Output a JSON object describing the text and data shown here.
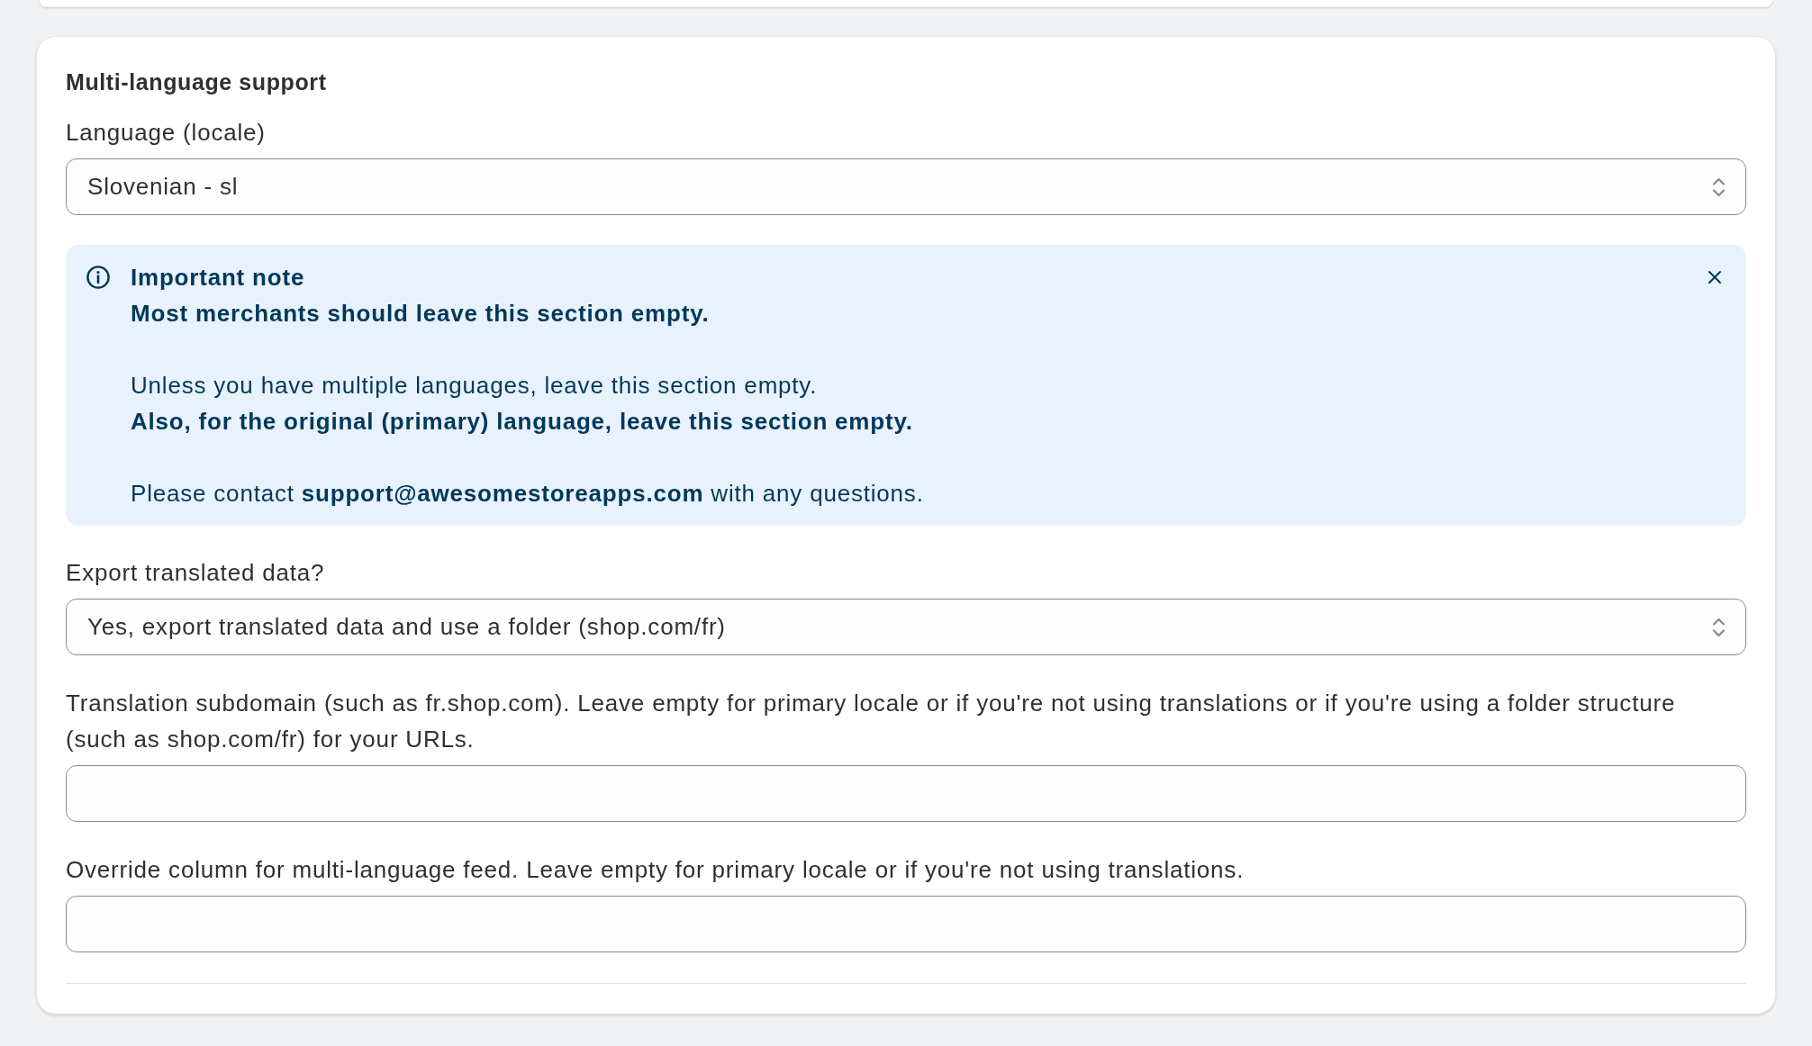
{
  "section": {
    "title": "Multi-language support",
    "items": [
      {
        "kind": "select",
        "label": "Language (locale)",
        "value": "Slovenian - sl"
      },
      {
        "kind": "note",
        "title": "Important note",
        "dismissible": true,
        "paragraphs": [
          {
            "lines": [
              {
                "text": "Most merchants should leave this section empty.",
                "bold": true
              }
            ]
          },
          {
            "lines": [
              {
                "text": "Unless you have multiple languages, leave this section empty.",
                "bold": false
              },
              {
                "text": "Also, for the original (primary) language, leave this section empty.",
                "bold": true
              }
            ]
          },
          {
            "lines": [
              {
                "text": "Please contact **support@awesomestoreapps.com** with any questions.",
                "bold": false
              }
            ]
          }
        ]
      },
      {
        "kind": "select",
        "label": "Export translated data?",
        "value": "Yes, export translated data and use a folder (shop.com/fr)"
      },
      {
        "kind": "text",
        "label": "Translation subdomain (such as fr.shop.com). Leave empty for primary locale or if you're not using translations or if you're using a folder structure (such as shop.com/fr) for your URLs."
      },
      {
        "kind": "text",
        "label": "Override column for multi-language feed. Leave empty for primary locale or if you're not using translations."
      }
    ]
  }
}
